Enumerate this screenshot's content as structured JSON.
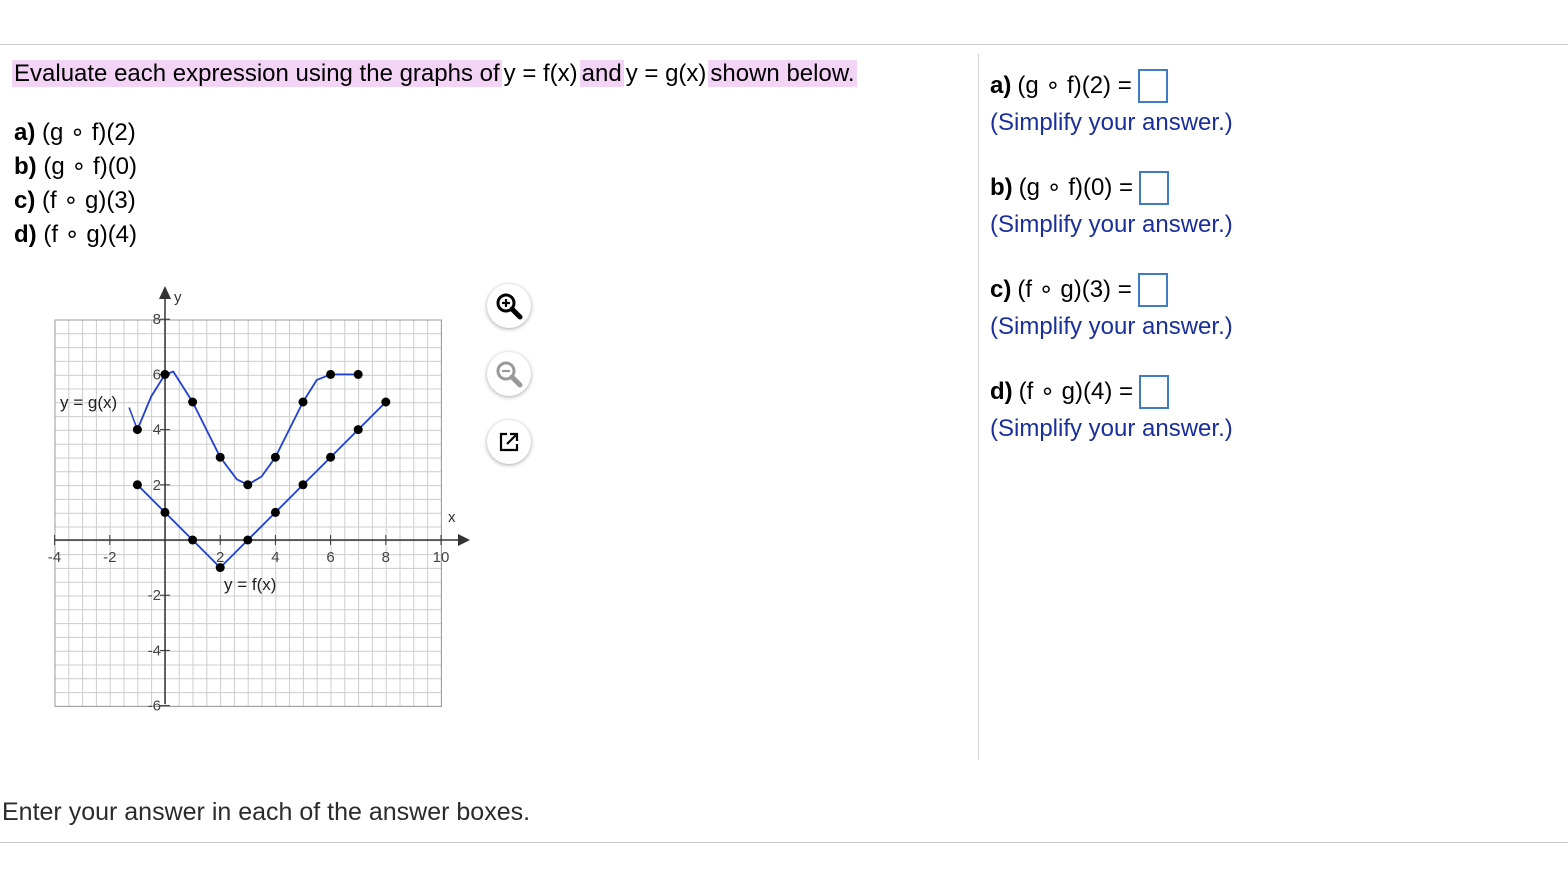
{
  "instruction": {
    "prefix": "Evaluate each expression using the graphs of",
    "f_label": "y = f(x)",
    "and": "and",
    "g_label": "y = g(x)",
    "suffix": "shown below."
  },
  "questions": [
    {
      "letter": "a)",
      "expr": "(g ∘ f)(2)"
    },
    {
      "letter": "b)",
      "expr": "(g ∘ f)(0)"
    },
    {
      "letter": "c)",
      "expr": "(f ∘ g)(3)"
    },
    {
      "letter": "d)",
      "expr": "(f ∘ g)(4)"
    }
  ],
  "graph": {
    "x_axis_label": "x",
    "y_axis_label": "y",
    "x_ticks": [
      "-4",
      "-2",
      "2",
      "4",
      "6",
      "8",
      "10"
    ],
    "y_ticks": [
      "8",
      "6",
      "4",
      "2",
      "-2",
      "-4",
      "-6"
    ],
    "g_curve_label": "y = g(x)",
    "f_curve_label": "y = f(x)",
    "curve_color": "#1f3fd6",
    "grid_color": "#cccccc"
  },
  "toolbar": {
    "zoom_in_icon": "zoom-in-icon",
    "zoom_out_icon": "zoom-out-icon",
    "popout_icon": "popout-icon"
  },
  "answers": [
    {
      "letter": "a)",
      "expr": "(g ∘ f)(2) =",
      "value": "",
      "hint": "(Simplify your answer.)"
    },
    {
      "letter": "b)",
      "expr": "(g ∘ f)(0) =",
      "value": "",
      "hint": "(Simplify your answer.)"
    },
    {
      "letter": "c)",
      "expr": "(f ∘ g)(3) =",
      "value": "",
      "hint": "(Simplify your answer.)"
    },
    {
      "letter": "d)",
      "expr": "(f ∘ g)(4) =",
      "value": "",
      "hint": "(Simplify your answer.)"
    }
  ],
  "footer": "Enter your answer in each of the answer boxes.",
  "colors": {
    "highlight": "#f3d4f7",
    "answer_box_border": "#3f7cc4",
    "hint_text": "#1a2f9c"
  }
}
